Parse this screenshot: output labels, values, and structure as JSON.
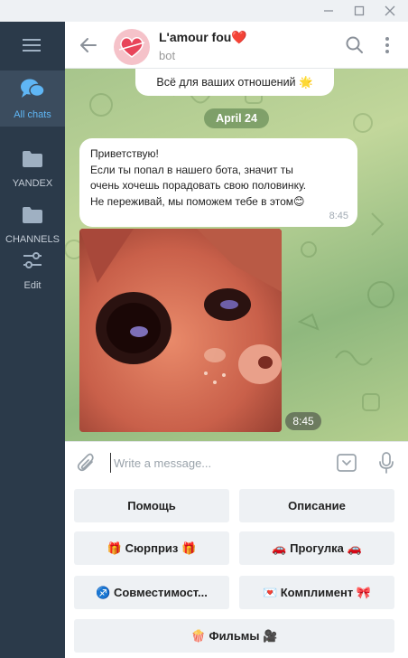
{
  "window": {
    "minimize_icon": "minimize-icon",
    "maximize_icon": "maximize-icon",
    "close_icon": "close-icon"
  },
  "sidebar": {
    "menu_icon": "hamburger-icon",
    "items": [
      {
        "label": "All chats",
        "icon": "chat-bubbles-icon",
        "active": true
      },
      {
        "label": "YANDEX",
        "icon": "folder-icon",
        "active": false
      },
      {
        "label": "CHANNELS",
        "icon": "folder-icon",
        "active": false
      },
      {
        "label": "Edit",
        "icon": "sliders-icon",
        "active": false
      }
    ]
  },
  "header": {
    "title": "L'amour fou❤️",
    "status": "bot"
  },
  "chat": {
    "top_message": "Всё для ваших отношений 🌟",
    "date": "April 24",
    "message_lines": [
      "Приветствую!",
      "Если ты попал в нашего бота, значит ты",
      "очень хочешь порадовать свою половинку.",
      "Не переживай, мы поможем тебе в этом😊"
    ],
    "message_time": "8:45",
    "photo_time": "8:45"
  },
  "composer": {
    "placeholder": "Write a message..."
  },
  "keyboard": {
    "buttons": [
      "Помощь",
      "Описание",
      "🎁 Сюрприз 🎁",
      "🚗 Прогулка 🚗",
      "♐️ Совместимост...",
      "💌 Комплимент 🎀",
      "🍿 Фильмы 🎥"
    ]
  },
  "colors": {
    "sidebar_bg": "#2b3a4a",
    "accent": "#5fb6f5",
    "button_bg": "#eef1f4"
  }
}
